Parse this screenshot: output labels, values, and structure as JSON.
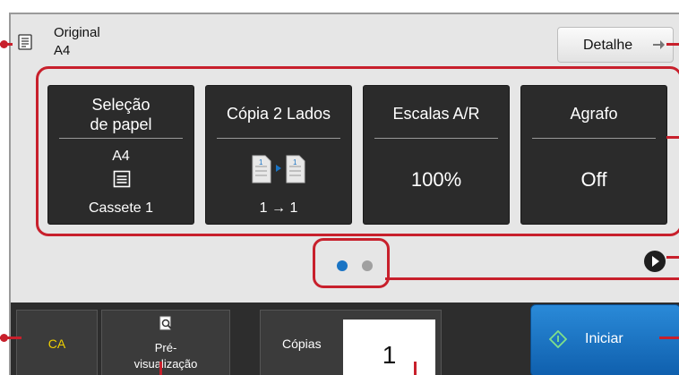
{
  "header": {
    "original_label": "Original",
    "original_size": "A4",
    "detail_label": "Detalhe"
  },
  "cards": [
    {
      "title_line1": "Seleção",
      "title_line2": "de papel",
      "value_top": "A4",
      "value_bottom": "Cassete 1",
      "icon": "paper-tray-icon"
    },
    {
      "title": "Cópia 2 Lados",
      "value": "1 → 1",
      "icon": "duplex-icon"
    },
    {
      "title": "Escalas A/R",
      "value": "100%"
    },
    {
      "title": "Agrafo",
      "value": "Off"
    }
  ],
  "pager": {
    "pages": 2,
    "active": 1
  },
  "bottom": {
    "ca_label": "CA",
    "preview_label_line1": "Pré-",
    "preview_label_line2": "visualização",
    "copies_label": "Cópias",
    "copies_value": "1",
    "start_label": "Iniciar"
  },
  "colors": {
    "callout": "#c8202c",
    "start": "#1a74c4",
    "ca_text": "#f0d000",
    "pager_active": "#1a74c4",
    "pager_inactive": "#a0a0a0"
  }
}
